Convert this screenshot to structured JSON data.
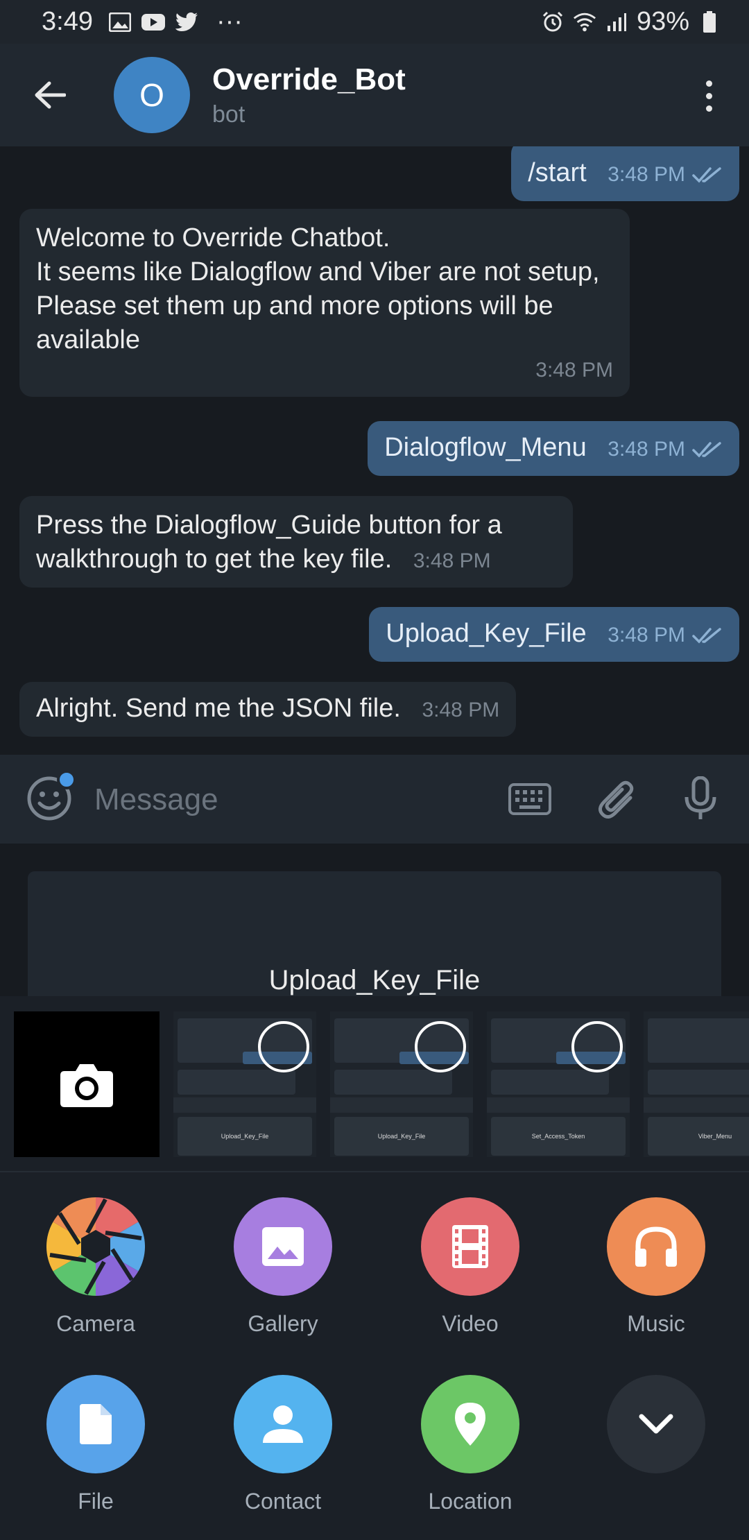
{
  "status_bar": {
    "time": "3:49",
    "more": "···",
    "battery": "93%"
  },
  "header": {
    "avatar_letter": "O",
    "title": "Override_Bot",
    "subtitle": "bot"
  },
  "messages": [
    {
      "dir": "out",
      "text": "/start",
      "time": "3:48 PM"
    },
    {
      "dir": "in",
      "text": "Welcome to Override Chatbot.\nIt seems like Dialogflow and Viber are not setup,\nPlease set them up and more options will be available",
      "time": "3:48 PM"
    },
    {
      "dir": "out",
      "text": "Dialogflow_Menu",
      "time": "3:48 PM"
    },
    {
      "dir": "in",
      "text": "Press the Dialogflow_Guide button for a walkthrough to get the key file.",
      "time": "3:48 PM"
    },
    {
      "dir": "out",
      "text": "Upload_Key_File",
      "time": "3:48 PM"
    },
    {
      "dir": "in",
      "text": "Alright. Send me the JSON file.",
      "time": "3:48 PM"
    }
  ],
  "composer": {
    "placeholder": "Message"
  },
  "bot_keyboard": {
    "button_label": "Upload_Key_File"
  },
  "gallery_thumbs": [
    "Upload_Key_File",
    "Upload_Key_File",
    "Set_Access_Token",
    "Viber_Menu"
  ],
  "attach_options": [
    {
      "label": "Camera",
      "icon": "camera-aperture-icon",
      "color": "multicolor"
    },
    {
      "label": "Gallery",
      "icon": "gallery-icon",
      "color": "#a77ee0"
    },
    {
      "label": "Video",
      "icon": "video-icon",
      "color": "#e36a70"
    },
    {
      "label": "Music",
      "icon": "headphones-icon",
      "color": "#ee8c55"
    },
    {
      "label": "File",
      "icon": "file-icon",
      "color": "#58a3ea"
    },
    {
      "label": "Contact",
      "icon": "contact-icon",
      "color": "#54b3ef"
    },
    {
      "label": "Location",
      "icon": "location-pin-icon",
      "color": "#6cc766"
    },
    {
      "label": "",
      "icon": "chevron-down-icon",
      "color": "#2a3038"
    }
  ]
}
